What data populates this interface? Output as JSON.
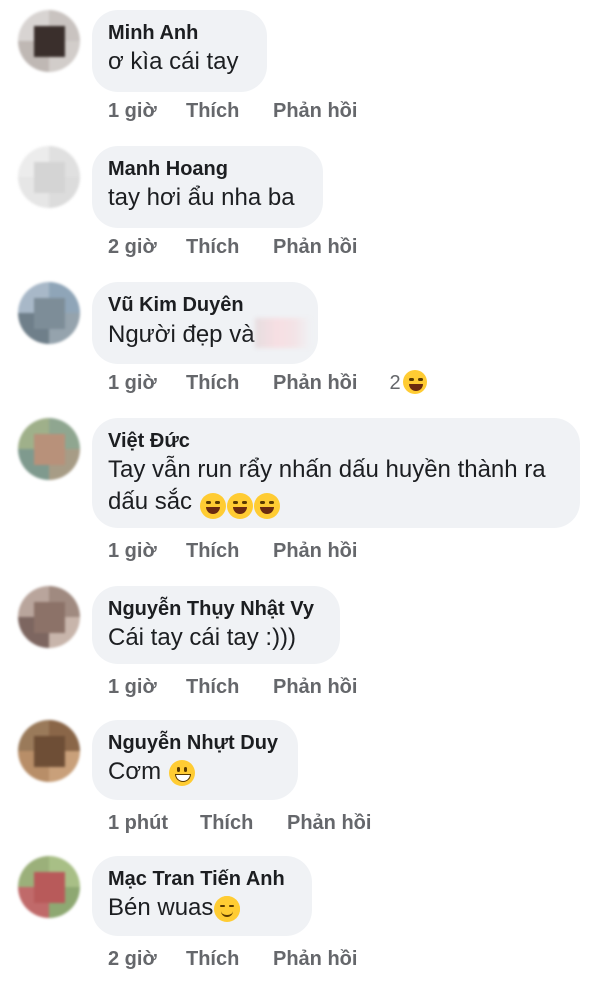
{
  "comments": [
    {
      "author": "Minh Anh",
      "text": "ơ kìa cái tay",
      "time": "1 giờ",
      "like_label": "Thích",
      "reply_label": "Phản hồi"
    },
    {
      "author": "Manh Hoang",
      "text": "tay hơi ẩu nha ba",
      "time": "2 giờ",
      "like_label": "Thích",
      "reply_label": "Phản hồi"
    },
    {
      "author": "Vũ Kim Duyên",
      "text": "Người đẹp và",
      "time": "1 giờ",
      "like_label": "Thích",
      "reply_label": "Phản hồi",
      "reaction_count": "2",
      "reaction_icon": "laughing-emoji"
    },
    {
      "author": "Việt Đức",
      "text_line1": "Tay vẫn run rẩy nhấn dấu huyền thành ra",
      "text_line2": "dấu sắc",
      "emoji_icon": "rolling-laughing-emoji",
      "time": "1 giờ",
      "like_label": "Thích",
      "reply_label": "Phản hồi"
    },
    {
      "author": "Nguyễn Thụy Nhật Vy",
      "text": "Cái tay cái tay :)))",
      "time": "1 giờ",
      "like_label": "Thích",
      "reply_label": "Phản hồi"
    },
    {
      "author": "Nguyễn Nhựt Duy",
      "text": "Cơm",
      "emoji_icon": "grinning-emoji",
      "time": "1 phút",
      "like_label": "Thích",
      "reply_label": "Phản hồi"
    },
    {
      "author": "Mạc Tran Tiến Anh",
      "text": "Bén wuas",
      "emoji_icon": "smiling-blush-emoji",
      "time": "2 giờ",
      "like_label": "Thích",
      "reply_label": "Phản hồi"
    }
  ],
  "colors": {
    "bubble_bg": "#f0f2f5",
    "author_text": "#1c1e21",
    "action_text": "#65676b",
    "emoji_yellow": "#ffcc33"
  }
}
